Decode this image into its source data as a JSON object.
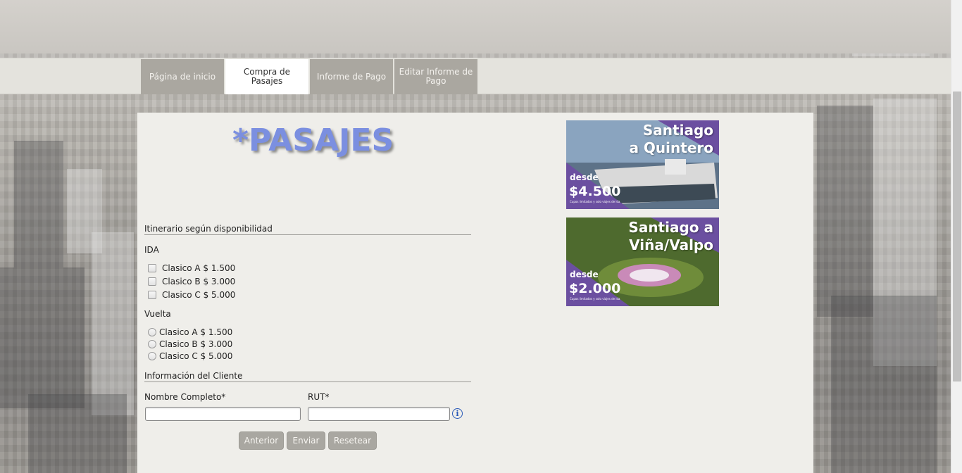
{
  "nav": {
    "items": [
      {
        "label": "Página de inicio"
      },
      {
        "label": "Compra de Pasajes"
      },
      {
        "label": "Informe de Pago"
      },
      {
        "label": "Editar Informe de Pago"
      }
    ],
    "active_index": 1
  },
  "page": {
    "title": "*PASAJES"
  },
  "itinerary": {
    "heading": "Itinerario según disponibilidad",
    "ida": {
      "label": "IDA",
      "options": [
        "Clasico A $ 1.500",
        "Clasico B $ 3.000",
        "Clasico C $ 5.000"
      ]
    },
    "vuelta": {
      "label": "Vuelta",
      "options": [
        "Clasico A $ 1.500",
        "Clasico B $ 3.000",
        "Clasico C $ 5.000"
      ]
    }
  },
  "client": {
    "heading": "Información del Cliente",
    "name_label": "Nombre Completo*",
    "name_value": "",
    "rut_label": "RUT*",
    "rut_value": "",
    "info_icon": "info-icon"
  },
  "buttons": {
    "prev": "Anterior",
    "send": "Enviar",
    "reset": "Resetear"
  },
  "banners": [
    {
      "headline_1": "Santiago",
      "headline_2": "a Quintero",
      "desde": "desde",
      "price": "$4.500",
      "fine": "Cupos limitados y solo viajes de ida",
      "color": "#6b4fa0"
    },
    {
      "headline_1": "Santiago a",
      "headline_2": "Viña/Valpo",
      "desde": "desde",
      "price": "$2.000",
      "fine": "Cupos limitados y solo viajes de ida",
      "color": "#6b4fa0"
    }
  ],
  "colors": {
    "title": "#7b8fe0",
    "nav_inactive": "#aaa7a0",
    "nav_active": "#ffffff",
    "panel": "#efeeea",
    "banner_purple": "#6b4fa0"
  }
}
